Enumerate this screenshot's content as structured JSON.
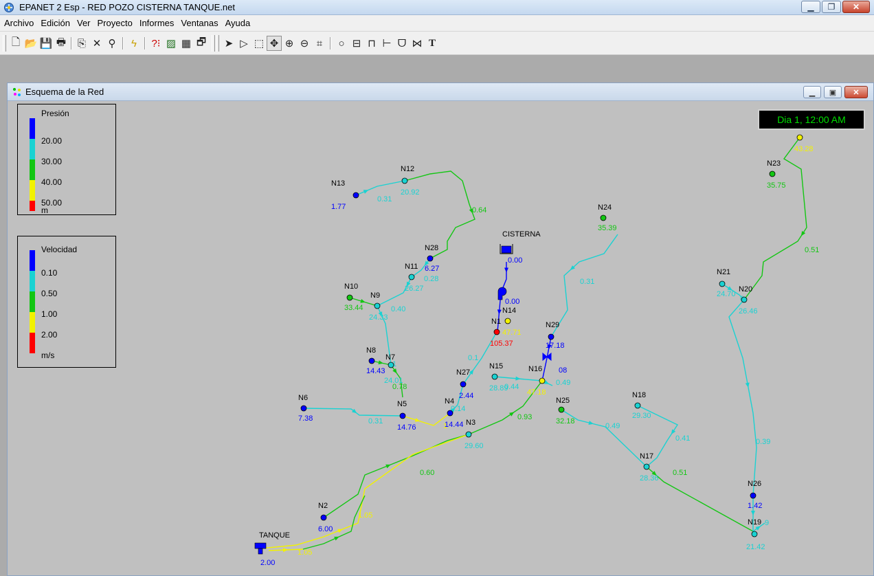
{
  "window": {
    "title": "EPANET 2 Esp - RED POZO CISTERNA TANQUE.net"
  },
  "menu": [
    "Archivo",
    "Edición",
    "Ver",
    "Proyecto",
    "Informes",
    "Ventanas",
    "Ayuda"
  ],
  "child": {
    "title": "Esquema de la Red",
    "time": "Dia 1, 12:00 AM"
  },
  "legend_pressure": {
    "title": "Presión",
    "values": [
      "20.00",
      "30.00",
      "40.00",
      "50.00",
      "m"
    ]
  },
  "legend_velocity": {
    "title": "Velocidad",
    "values": [
      "0.10",
      "0.50",
      "1.00",
      "2.00",
      "m/s"
    ]
  },
  "colors": {
    "blue": "#0000ff",
    "cyan": "#1ad2d2",
    "green": "#13c613",
    "yellow": "#f2f200",
    "red": "#ff0000"
  },
  "nodes": [
    {
      "id": "N13",
      "value": "1.77",
      "color": "blue"
    },
    {
      "id": "N12",
      "value": "20.92",
      "color": "cyan"
    },
    {
      "id": "N28",
      "value": "6.27",
      "color": "blue"
    },
    {
      "id": "N11",
      "value": "26.27",
      "color": "cyan"
    },
    {
      "id": "N10",
      "value": "33.44",
      "color": "green"
    },
    {
      "id": "N9",
      "value": "24.33",
      "color": "cyan"
    },
    {
      "id": "N8",
      "value": "14.43",
      "color": "blue"
    },
    {
      "id": "N7",
      "value": "24.01",
      "color": "cyan"
    },
    {
      "id": "N6",
      "value": "7.38",
      "color": "blue"
    },
    {
      "id": "N5",
      "value": "14.76",
      "color": "blue"
    },
    {
      "id": "N4",
      "value": "14.44",
      "color": "blue"
    },
    {
      "id": "N3",
      "value": "29.60",
      "color": "cyan"
    },
    {
      "id": "N27",
      "value": "2.44",
      "color": "blue"
    },
    {
      "id": "N1",
      "value": "105.37",
      "color": "red"
    },
    {
      "id": "N14",
      "value": "47.71",
      "color": "yellow"
    },
    {
      "id": "N15",
      "value": "28.89",
      "color": "cyan"
    },
    {
      "id": "N16",
      "value": "47.18",
      "color": "yellow"
    },
    {
      "id": "N29",
      "value": "17.18",
      "color": "blue"
    },
    {
      "id": "N25",
      "value": "32.18",
      "color": "green"
    },
    {
      "id": "N24",
      "value": "35.39",
      "color": "green"
    },
    {
      "id": "N18",
      "value": "29.30",
      "color": "cyan"
    },
    {
      "id": "N17",
      "value": "28.36",
      "color": "cyan"
    },
    {
      "id": "N21",
      "value": "24.70",
      "color": "cyan"
    },
    {
      "id": "N20",
      "value": "26.46",
      "color": "cyan"
    },
    {
      "id": "N23",
      "value": "35.75",
      "color": "green"
    },
    {
      "id": "N22",
      "value": "43.28",
      "color": "yellow"
    },
    {
      "id": "N26",
      "value": "1.42",
      "color": "blue"
    },
    {
      "id": "N19",
      "value": "21.42",
      "color": "cyan"
    },
    {
      "id": "N2",
      "value": "6.00",
      "color": "blue"
    }
  ],
  "sources": [
    {
      "id": "CISTERNA",
      "value": "0.00"
    },
    {
      "id": "TANQUE",
      "value": "2.00"
    }
  ],
  "pump": {
    "value": "0.00"
  },
  "links": [
    {
      "label": "0.31",
      "color": "cyan"
    },
    {
      "label": "0.64",
      "color": "green"
    },
    {
      "label": "0.28",
      "color": "cyan"
    },
    {
      "label": "0.40",
      "color": "cyan"
    },
    {
      "label": "1",
      "color": "cyan"
    },
    {
      "label": "0.78",
      "color": "green"
    },
    {
      "label": "0.31",
      "color": "cyan"
    },
    {
      "label": "1",
      "color": "yellow"
    },
    {
      "label": "0.14",
      "color": "cyan"
    },
    {
      "label": "0.1",
      "color": "cyan"
    },
    {
      "label": "0.44",
      "color": "cyan"
    },
    {
      "label": "0.49",
      "color": "cyan"
    },
    {
      "label": "08",
      "color": "blue"
    },
    {
      "label": "0.93",
      "color": "green"
    },
    {
      "label": "0.60",
      "color": "green"
    },
    {
      "label": "1.05",
      "color": "yellow"
    },
    {
      "label": "1.05",
      "color": "yellow"
    },
    {
      "label": "0.31",
      "color": "cyan"
    },
    {
      "label": "0.49",
      "color": "cyan"
    },
    {
      "label": "0.41",
      "color": "cyan"
    },
    {
      "label": "0.51",
      "color": "green"
    },
    {
      "label": "0.51",
      "color": "green"
    },
    {
      "label": "0.39",
      "color": "cyan"
    },
    {
      "label": "0",
      "color": "cyan"
    },
    {
      "label": "9",
      "color": "cyan"
    }
  ]
}
